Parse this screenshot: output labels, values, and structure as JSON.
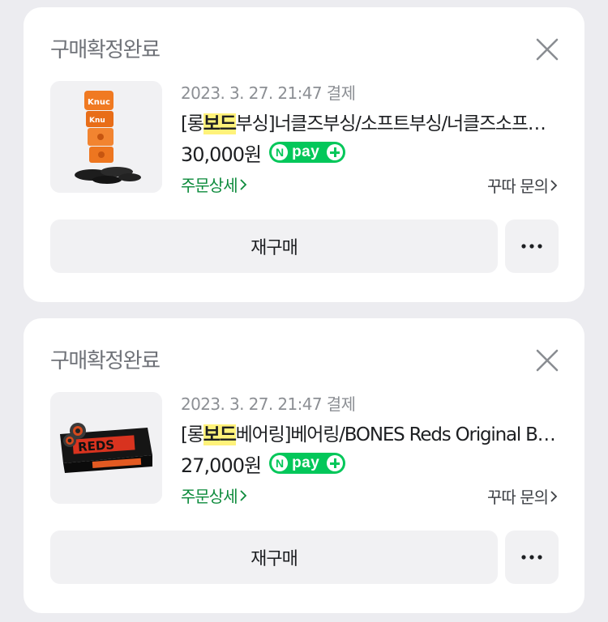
{
  "orders": [
    {
      "status": "구매확정완료",
      "date": "2023. 3. 27. 21:47 결제",
      "title_prefix": "[롱",
      "title_highlight": "보드",
      "title_suffix": "부싱]너클즈부싱/소프트부싱/너클즈소프트부싱/롱보드부싱",
      "price": "30,000원",
      "npay_label": "pay",
      "detail_link": "주문상세",
      "inquiry_link": "꾸따 문의",
      "rebuy_label": "재구매",
      "product_image": "orange-bushings-photo"
    },
    {
      "status": "구매확정완료",
      "date": "2023. 3. 27. 21:47 결제",
      "title_prefix": "[롱",
      "title_highlight": "보드",
      "title_suffix": "베어링]베어링/BONES Reds Original Bearings",
      "price": "27,000원",
      "npay_label": "pay",
      "detail_link": "주문상세",
      "inquiry_link": "꾸따 문의",
      "rebuy_label": "재구매",
      "product_image": "bones-reds-bearings-photo"
    }
  ],
  "colors": {
    "background": "#ececf0",
    "card": "#ffffff",
    "npay_green": "#03c75a",
    "link_green": "#0d8b3c",
    "highlight": "#fff27a"
  },
  "icons": {
    "close": "close-icon",
    "chevron": "chevron-right-icon",
    "more": "more-dots-icon"
  }
}
